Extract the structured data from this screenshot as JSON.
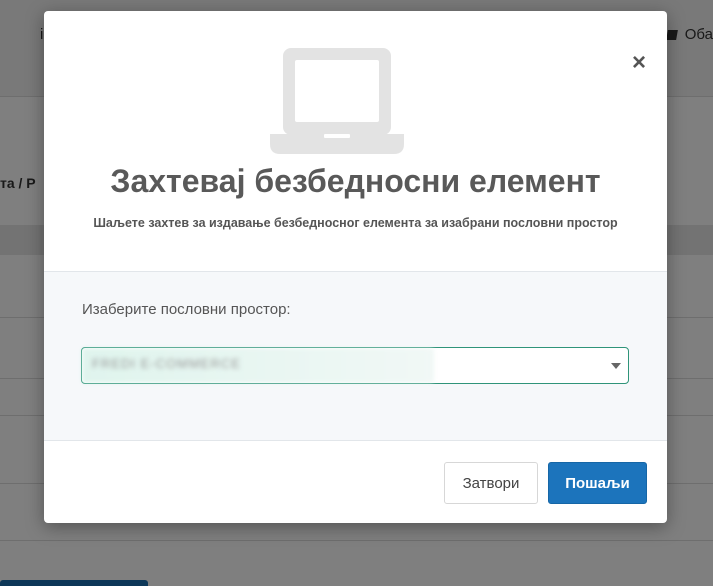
{
  "background": {
    "header_right_text": "Оба",
    "header_left_text": "i",
    "breadcrumb_text": "та  /  P"
  },
  "modal": {
    "close_glyph": "×",
    "icon": "laptop-icon",
    "title": "Захтевај безбедносни елемент",
    "subtitle": "Шаљете захтев за издавање безбедносног елемента за изабрани пословни простор",
    "field_label": "Изаберите пословни простор:",
    "select_value": "FREDI E-COMMERCE",
    "buttons": {
      "close": "Затвори",
      "send": "Пошаљи"
    }
  },
  "colors": {
    "primary": "#1c74bc",
    "select_border": "#2f9479",
    "icon_gray": "#e3e3e3",
    "title_gray": "#595959"
  }
}
